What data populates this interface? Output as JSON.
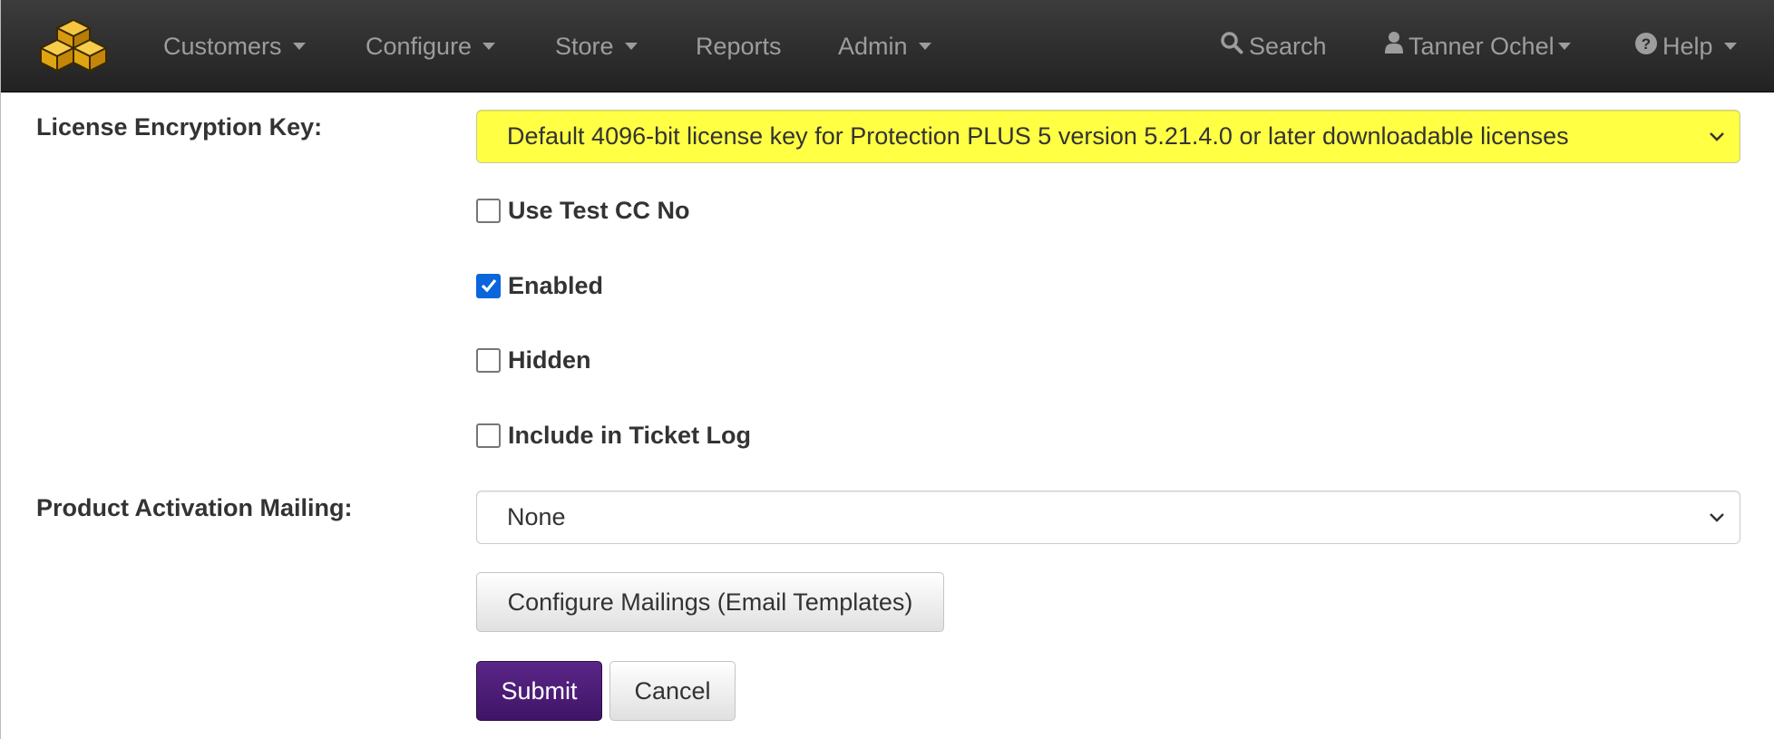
{
  "navbar": {
    "brand_icon": "yellow-cubes-logo",
    "items": [
      {
        "label": "Customers",
        "dropdown": true
      },
      {
        "label": "Configure",
        "dropdown": true
      },
      {
        "label": "Store",
        "dropdown": true
      },
      {
        "label": "Reports",
        "dropdown": false
      },
      {
        "label": "Admin",
        "dropdown": true
      }
    ],
    "search_label": "Search",
    "search_icon": "search-icon",
    "user_label": "Tanner Ochel",
    "user_icon": "user-icon",
    "help_label": "Help",
    "help_icon": "question-circle-icon"
  },
  "form": {
    "license_key": {
      "label": "License Encryption Key:",
      "selected": "Default 4096-bit license key for Protection PLUS 5 version 5.21.4.0 or later downloadable licenses",
      "highlight_color": "#ffff44"
    },
    "checkboxes": [
      {
        "label": "Use Test CC No",
        "checked": false
      },
      {
        "label": "Enabled",
        "checked": true
      },
      {
        "label": "Hidden",
        "checked": false
      },
      {
        "label": "Include in Ticket Log",
        "checked": false
      }
    ],
    "activation_mailing": {
      "label": "Product Activation Mailing:",
      "selected": "None"
    },
    "configure_mailings_label": "Configure Mailings (Email Templates)",
    "submit_label": "Submit",
    "cancel_label": "Cancel"
  },
  "colors": {
    "navbar_bg": "#2a2a2a",
    "nav_text": "#9d9d9d",
    "primary_button": "#4a1a73",
    "checkbox_checked": "#0a66da"
  }
}
